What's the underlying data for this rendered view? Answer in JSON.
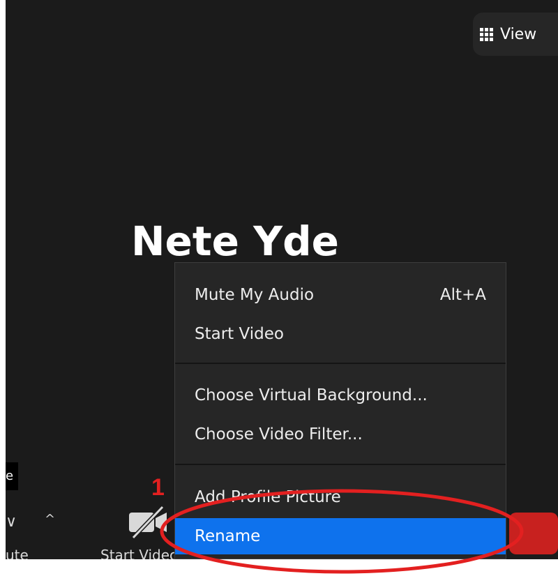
{
  "view_button": {
    "label": "View",
    "icon": "grid-icon"
  },
  "participant": {
    "name": "Nete Yde",
    "name_tag": "e"
  },
  "toolbar": {
    "left_label": "ute",
    "video_label": "Start Video",
    "video_icon": "video-off-icon",
    "caret_icon": "caret-up-icon"
  },
  "menu": {
    "items": [
      {
        "label": "Mute My Audio",
        "shortcut": "Alt+A"
      },
      {
        "label": "Start Video"
      },
      {
        "label": "Choose Virtual Background..."
      },
      {
        "label": "Choose Video Filter..."
      },
      {
        "label": "Add Profile Picture"
      },
      {
        "label": "Rename"
      }
    ],
    "selected_index": 5
  },
  "annotation": {
    "step_number": "1",
    "color": "#e32020"
  },
  "colors": {
    "background": "#1b1b1b",
    "menu_bg": "#262626",
    "selected": "#0e72ed",
    "end_button": "#c8211f"
  }
}
